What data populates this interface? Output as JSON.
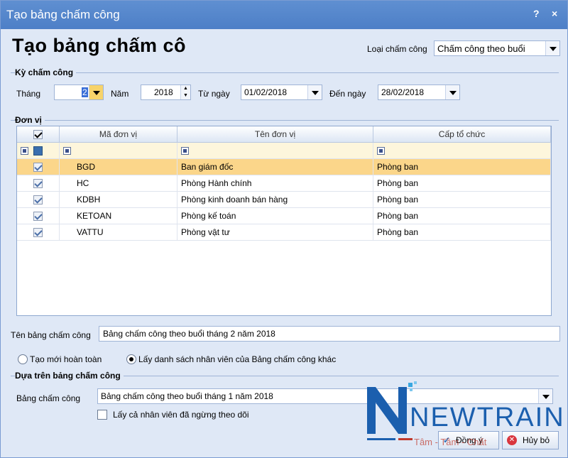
{
  "window": {
    "title": "Tạo bảng chấm công",
    "help_label": "?",
    "close_label": "×"
  },
  "page_title": "Tạo bảng chấm cô",
  "loai_cham_cong": {
    "label": "Loại chấm công",
    "value": "Chấm công theo buổi"
  },
  "ky_cham_cong": {
    "group_title": "Kỳ chấm công",
    "thang_label": "Tháng",
    "thang_value": "2",
    "nam_label": "Năm",
    "nam_value": "2018",
    "tu_ngay_label": "Từ ngày",
    "tu_ngay_value": "01/02/2018",
    "den_ngay_label": "Đến ngày",
    "den_ngay_value": "28/02/2018"
  },
  "don_vi": {
    "group_title": "Đơn vị",
    "columns": [
      "Mã đơn vị",
      "Tên đơn vị",
      "Cấp tổ chức"
    ],
    "rows": [
      {
        "ma": "BGD",
        "ten": "Ban giám đốc",
        "cap": "Phòng ban"
      },
      {
        "ma": "HC",
        "ten": "Phòng Hành chính",
        "cap": "Phòng ban"
      },
      {
        "ma": "KDBH",
        "ten": "Phòng kinh doanh bán hàng",
        "cap": "Phòng ban"
      },
      {
        "ma": "KETOAN",
        "ten": "Phòng kế toán",
        "cap": "Phòng ban"
      },
      {
        "ma": "VATTU",
        "ten": "Phòng vật tư",
        "cap": "Phòng ban"
      }
    ]
  },
  "ten_bang": {
    "label": "Tên bảng chấm công",
    "value": "Bảng chấm công theo buổi tháng 2 năm 2018"
  },
  "options": {
    "tao_moi": "Tạo mới hoàn toàn",
    "lay_danh_sach": "Lấy danh sách nhân viên của Bảng chấm công khác"
  },
  "dua_tren": {
    "group_title": "Dựa trên bảng chấm công",
    "bang_label": "Bảng chấm công",
    "bang_value": "Bảng chấm công theo buổi tháng 1 năm 2018",
    "lay_ca_label": "Lấy cả nhân viên đã ngừng theo dõi"
  },
  "buttons": {
    "dong_y": "Đồng ý",
    "huy_bo": "Hủy bỏ"
  },
  "logo": {
    "brand": "NEWTRAIN",
    "tagline": "Tâm - Tầm - Chất"
  },
  "colors": {
    "titlebar": "#4d7fc7",
    "selected_row": "#fbd68a",
    "logo_blue": "#1b5fae",
    "logo_red": "#c0392b"
  }
}
